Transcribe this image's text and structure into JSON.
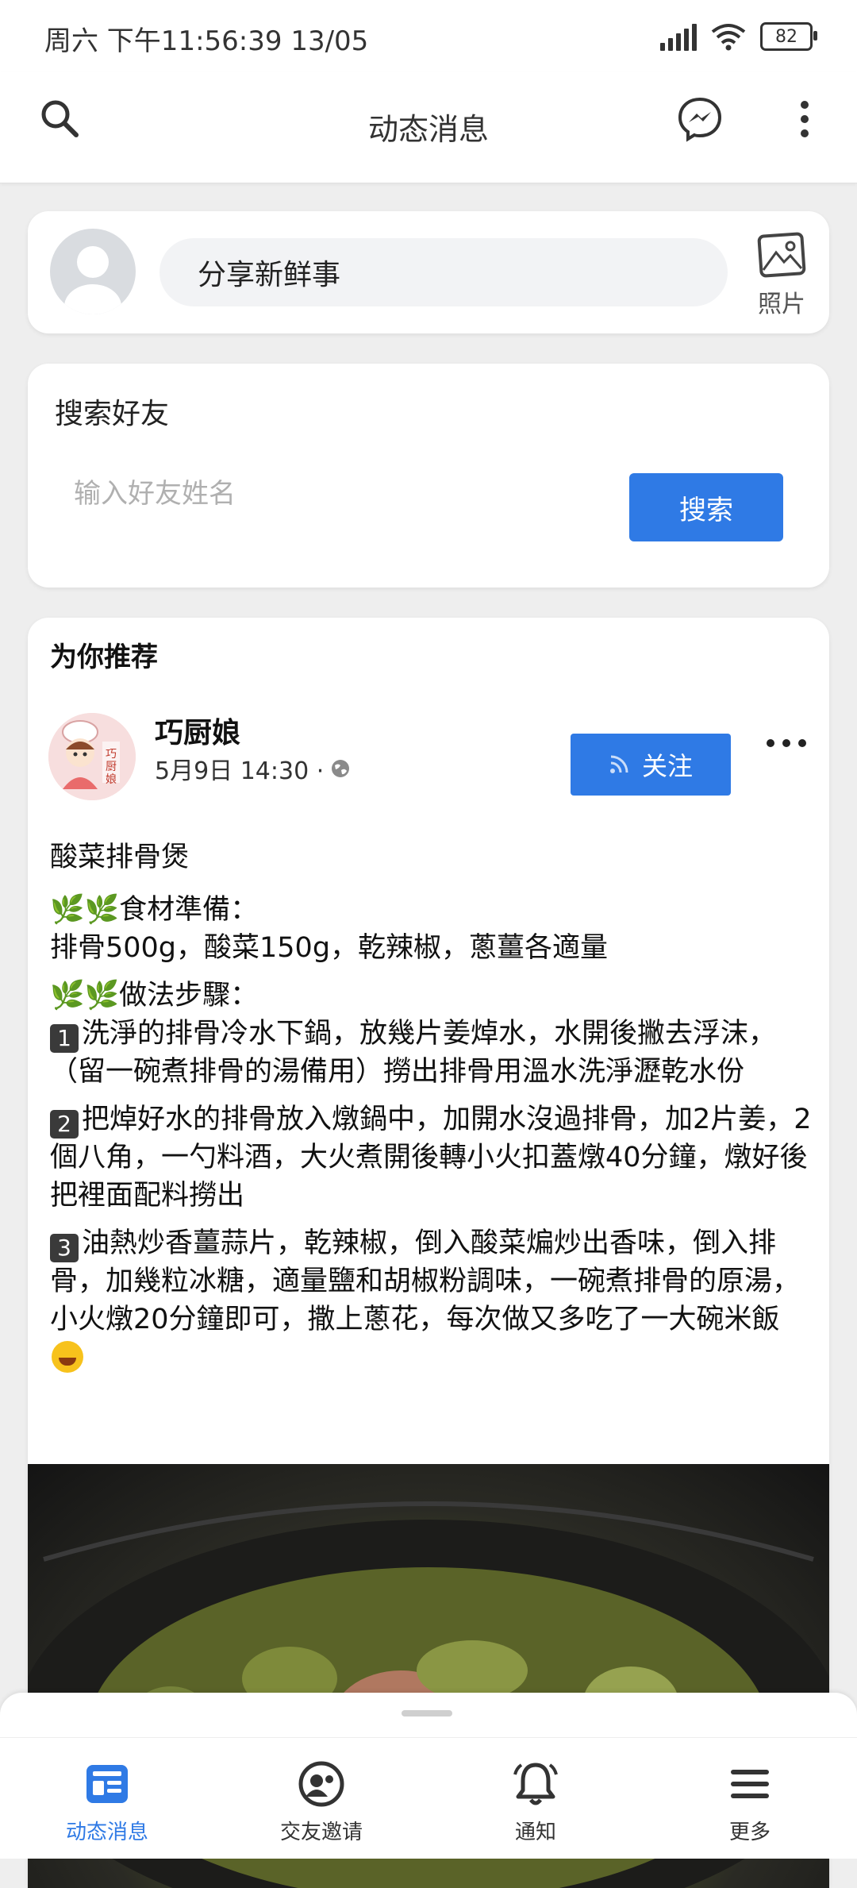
{
  "status_bar": {
    "time": "周六 下午11:56:39 13/05",
    "battery": "82"
  },
  "app_bar": {
    "title": "动态消息"
  },
  "composer": {
    "placeholder": "分享新鲜事",
    "photo_label": "照片"
  },
  "friend_search": {
    "title": "搜索好友",
    "placeholder": "输入好友姓名",
    "button_label": "搜索"
  },
  "feed": {
    "section_title": "为你推荐",
    "post": {
      "author": "巧厨娘",
      "avatar_text": "巧厨娘",
      "timestamp": "5月9日 14:30 ·",
      "follow_label": "关注",
      "title": "酸菜排骨煲",
      "ingredients_heading": "食材準備：",
      "ingredients": "排骨500g，酸菜150g，乾辣椒，蔥薑各適量",
      "method_heading": "做法步驟：",
      "steps": [
        {
          "num": "1",
          "text": "洗淨的排骨冷水下鍋，放幾片姜焯水，水開後撇去浮沫，（留一碗煮排骨的湯備用）撈出排骨用溫水洗淨瀝乾水份"
        },
        {
          "num": "2",
          "text": "把焯好水的排骨放入燉鍋中，加開水沒過排骨，加2片姜，2個八角，一勺料酒，大火煮開後轉小火扣蓋燉40分鐘，燉好後把裡面配料撈出"
        },
        {
          "num": "3",
          "text": "油熱炒香薑蒜片，乾辣椒，倒入酸菜煸炒出香味，倒入排骨，加幾粒冰糖，適量鹽和胡椒粉調味，一碗煮排骨的原湯，小火燉20分鐘即可，撒上蔥花，每次做又多吃了一大碗米飯"
        }
      ]
    }
  },
  "bottom_nav": {
    "items": [
      {
        "label": "动态消息",
        "icon": "news-feed-icon",
        "active": true
      },
      {
        "label": "交友邀请",
        "icon": "friend-requests-icon",
        "active": false
      },
      {
        "label": "通知",
        "icon": "bell-icon",
        "active": false
      },
      {
        "label": "更多",
        "icon": "menu-icon",
        "active": false
      }
    ]
  },
  "colors": {
    "accent": "#2f7ae5",
    "background": "#eeeeee"
  }
}
